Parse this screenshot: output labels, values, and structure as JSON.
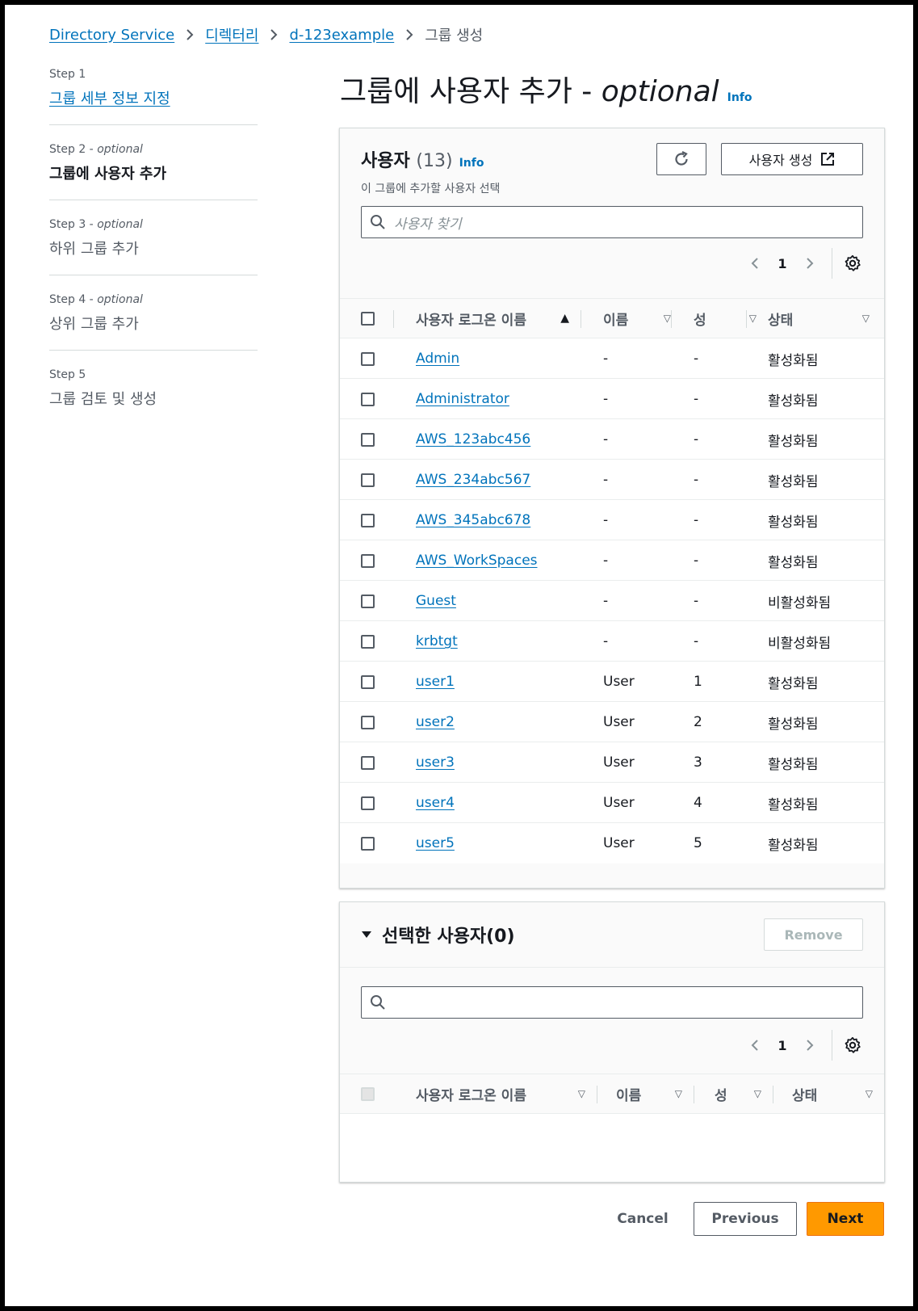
{
  "breadcrumb": {
    "items": [
      "Directory Service",
      "디렉터리",
      "d-123example"
    ],
    "current": "그룹 생성"
  },
  "steps": [
    {
      "num": "Step 1",
      "optional": "",
      "title": "그룹 세부 정보 지정"
    },
    {
      "num": "Step 2",
      "optional": "optional",
      "title": "그룹에 사용자 추가"
    },
    {
      "num": "Step 3",
      "optional": "optional",
      "title": "하위 그룹 추가"
    },
    {
      "num": "Step 4",
      "optional": "optional",
      "title": "상위 그룹 추가"
    },
    {
      "num": "Step 5",
      "optional": "",
      "title": "그룹 검토 및 생성"
    }
  ],
  "page": {
    "title": "그룹에 사용자 추가",
    "title_optional": "optional",
    "info": "Info"
  },
  "users_panel": {
    "title": "사용자",
    "count": "(13)",
    "info": "Info",
    "description": "이 그룹에 추가할 사용자 선택",
    "create_button": "사용자 생성",
    "search_placeholder": "사용자 찾기",
    "page_number": "1",
    "columns": [
      "사용자 로그온 이름",
      "이름",
      "성",
      "상태"
    ],
    "rows": [
      {
        "logon": "Admin",
        "first": "-",
        "last": "-",
        "status": "활성화됨"
      },
      {
        "logon": "Administrator",
        "first": "-",
        "last": "-",
        "status": "활성화됨"
      },
      {
        "logon": "AWS_123abc456",
        "first": "-",
        "last": "-",
        "status": "활성화됨"
      },
      {
        "logon": "AWS_234abc567",
        "first": "-",
        "last": "-",
        "status": "활성화됨"
      },
      {
        "logon": "AWS_345abc678",
        "first": "-",
        "last": "-",
        "status": "활성화됨"
      },
      {
        "logon": "AWS_WorkSpaces",
        "first": "-",
        "last": "-",
        "status": "활성화됨"
      },
      {
        "logon": "Guest",
        "first": "-",
        "last": "-",
        "status": "비활성화됨"
      },
      {
        "logon": "krbtgt",
        "first": "-",
        "last": "-",
        "status": "비활성화됨"
      },
      {
        "logon": "user1",
        "first": "User",
        "last": "1",
        "status": "활성화됨"
      },
      {
        "logon": "user2",
        "first": "User",
        "last": "2",
        "status": "활성화됨"
      },
      {
        "logon": "user3",
        "first": "User",
        "last": "3",
        "status": "활성화됨"
      },
      {
        "logon": "user4",
        "first": "User",
        "last": "4",
        "status": "활성화됨"
      },
      {
        "logon": "user5",
        "first": "User",
        "last": "5",
        "status": "활성화됨"
      }
    ]
  },
  "selected_panel": {
    "title": "선택한 사용자(0)",
    "remove_button": "Remove",
    "search_placeholder": "",
    "page_number": "1",
    "columns": [
      "사용자 로그온 이름",
      "이름",
      "성",
      "상태"
    ]
  },
  "footer": {
    "cancel": "Cancel",
    "previous": "Previous",
    "next": "Next"
  },
  "colors": {
    "link": "#0073bb",
    "primary_button": "#ff9900",
    "text": "#16191f",
    "muted": "#545b64"
  }
}
